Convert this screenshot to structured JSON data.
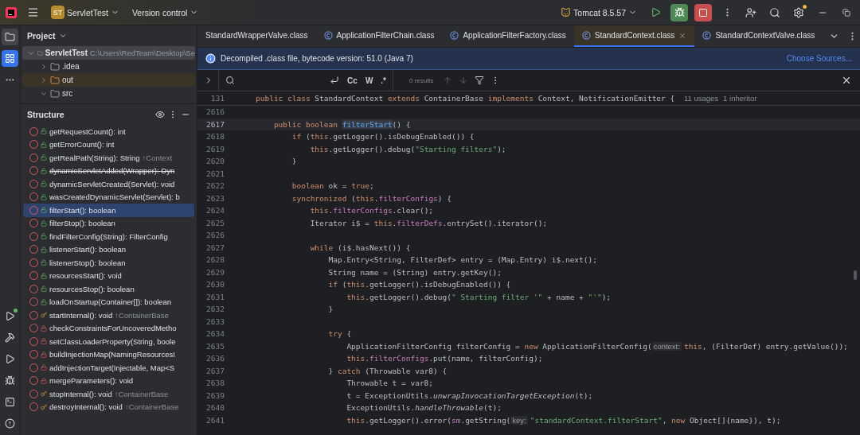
{
  "title_bar": {
    "project_badge": "ST",
    "project": "ServletTest",
    "vcs": "Version control",
    "run_config": "Tomcat 8.5.57"
  },
  "tool_strip": {
    "top": [
      {
        "kind": "project",
        "selected": true
      },
      {
        "kind": "structure",
        "selected": true
      },
      {
        "kind": "more",
        "selected": false
      }
    ],
    "bottom": [
      {
        "kind": "services",
        "selected": false
      },
      {
        "kind": "build",
        "selected": false
      },
      {
        "kind": "run",
        "selected": false
      },
      {
        "kind": "debug",
        "selected": false
      },
      {
        "kind": "terminal",
        "selected": false
      },
      {
        "kind": "problems",
        "selected": false
      }
    ]
  },
  "project_panel": {
    "title": "Project",
    "tree": [
      {
        "label": "ServletTest",
        "path": "C:\\Users\\RedTeam\\Desktop\\Se",
        "selected": true,
        "expanded": true,
        "excluded": false,
        "children": [
          {
            "label": ".idea",
            "selected": false,
            "expanded": false,
            "excluded": false
          },
          {
            "label": "out",
            "selected": false,
            "expanded": false,
            "excluded": true
          },
          {
            "label": "src",
            "selected": false,
            "expanded": true,
            "excluded": false
          }
        ]
      }
    ]
  },
  "structure_panel": {
    "title": "Structure",
    "items": [
      {
        "label": "getRequestCount(): int",
        "kind": "public",
        "selected": false,
        "deprecated": false
      },
      {
        "label": "getErrorCount(): int",
        "kind": "public",
        "selected": false,
        "deprecated": false
      },
      {
        "label": "getRealPath(String): String",
        "inherited": "↑Context",
        "kind": "public",
        "selected": false,
        "deprecated": false
      },
      {
        "label": "dynamicServletAdded(Wrapper): Dyn",
        "kind": "public",
        "selected": false,
        "deprecated": true
      },
      {
        "label": "dynamicServletCreated(Servlet): void",
        "kind": "public",
        "selected": false,
        "deprecated": false
      },
      {
        "label": "wasCreatedDynamicServlet(Servlet): b",
        "kind": "public",
        "selected": false,
        "deprecated": false
      },
      {
        "label": "filterStart(): boolean",
        "kind": "public",
        "selected": true,
        "deprecated": false
      },
      {
        "label": "filterStop(): boolean",
        "kind": "public",
        "selected": false,
        "deprecated": false
      },
      {
        "label": "findFilterConfig(String): FilterConfig",
        "kind": "public",
        "selected": false,
        "deprecated": false
      },
      {
        "label": "listenerStart(): boolean",
        "kind": "public",
        "selected": false,
        "deprecated": false
      },
      {
        "label": "listenerStop(): boolean",
        "kind": "public",
        "selected": false,
        "deprecated": false
      },
      {
        "label": "resourcesStart(): void",
        "kind": "public",
        "selected": false,
        "deprecated": false
      },
      {
        "label": "resourcesStop(): boolean",
        "kind": "public",
        "selected": false,
        "deprecated": false
      },
      {
        "label": "loadOnStartup(Container[]): boolean",
        "kind": "public",
        "selected": false,
        "deprecated": false
      },
      {
        "label": "startInternal(): void",
        "inherited": "↑ContainerBase",
        "kind": "protected",
        "selected": false,
        "deprecated": false
      },
      {
        "label": "checkConstraintsForUncoveredMetho",
        "kind": "private",
        "selected": false,
        "deprecated": false
      },
      {
        "label": "setClassLoaderProperty(String, boole",
        "kind": "private",
        "selected": false,
        "deprecated": false
      },
      {
        "label": "buildInjectionMap(NamingResourcesI",
        "kind": "private",
        "selected": false,
        "deprecated": false
      },
      {
        "label": "addInjectionTarget(Injectable, Map<S",
        "kind": "private",
        "selected": false,
        "deprecated": false
      },
      {
        "label": "mergeParameters(): void",
        "kind": "private",
        "selected": false,
        "deprecated": false
      },
      {
        "label": "stopInternal(): void",
        "inherited": "↑ContainerBase",
        "kind": "protected",
        "selected": false,
        "deprecated": false
      },
      {
        "label": "destroyInternal(): void",
        "inherited": "↑ContainerBase",
        "kind": "protected",
        "selected": false,
        "deprecated": false
      }
    ]
  },
  "tabs": [
    {
      "label": "StandardWrapperValve.class",
      "icon": false,
      "selected": false
    },
    {
      "label": "ApplicationFilterChain.class",
      "icon": true,
      "selected": false
    },
    {
      "label": "ApplicationFilterFactory.class",
      "icon": true,
      "selected": false
    },
    {
      "label": "StandardContext.class",
      "icon": true,
      "selected": true
    },
    {
      "label": "StandardContextValve.class",
      "icon": true,
      "selected": false
    }
  ],
  "banner": {
    "message": "Decompiled .class file, bytecode version: 51.0 (Java 7)",
    "link": "Choose Sources..."
  },
  "find_bar": {
    "match_case": "Cc",
    "words": "W",
    "regex": ".*",
    "results": "0 results"
  },
  "editor": {
    "sticky": {
      "no": "131",
      "tokens": [
        {
          "kind": "kw",
          "text": "public class "
        },
        {
          "kind": "p",
          "text": "StandardContext "
        },
        {
          "kind": "kw",
          "text": "extends "
        },
        {
          "kind": "p",
          "text": "ContainerBase "
        },
        {
          "kind": "kw",
          "text": "implements "
        },
        {
          "kind": "p",
          "text": "Context, NotificationEmitter { "
        },
        {
          "kind": "usage",
          "text": "11 usages"
        },
        {
          "kind": "usage",
          "text": "1 inheritor"
        }
      ]
    },
    "lines": [
      {
        "no": "2616",
        "current": false
      },
      {
        "no": "2617",
        "current": true,
        "tokens": [
          {
            "kind": "kw",
            "text": "    public boolean "
          },
          {
            "kind": "decl",
            "text": "filterStart"
          },
          {
            "kind": "p",
            "text": "() {"
          }
        ]
      },
      {
        "no": "2618",
        "current": false,
        "tokens": [
          {
            "kind": "kw",
            "text": "        if "
          },
          {
            "kind": "p",
            "text": "("
          },
          {
            "kind": "kw",
            "text": "this"
          },
          {
            "kind": "p",
            "text": ".getLogger().isDebugEnabled()) {"
          }
        ]
      },
      {
        "no": "2619",
        "current": false,
        "tokens": [
          {
            "kind": "kw",
            "text": "            this"
          },
          {
            "kind": "p",
            "text": ".getLogger().debug("
          },
          {
            "kind": "str",
            "text": "\"Starting filters\""
          },
          {
            "kind": "p",
            "text": ");"
          }
        ]
      },
      {
        "no": "2620",
        "current": false,
        "tokens": [
          {
            "kind": "p",
            "text": "        }"
          }
        ]
      },
      {
        "no": "2621",
        "current": false
      },
      {
        "no": "2622",
        "current": false,
        "tokens": [
          {
            "kind": "kw",
            "text": "        boolean "
          },
          {
            "kind": "p",
            "text": "ok = "
          },
          {
            "kind": "kw",
            "text": "true"
          },
          {
            "kind": "p",
            "text": ";"
          }
        ]
      },
      {
        "no": "2623",
        "current": false,
        "tokens": [
          {
            "kind": "kw",
            "text": "        synchronized "
          },
          {
            "kind": "p",
            "text": "("
          },
          {
            "kind": "kw",
            "text": "this"
          },
          {
            "kind": "p",
            "text": "."
          },
          {
            "kind": "f",
            "text": "filterConfigs"
          },
          {
            "kind": "p",
            "text": ") {"
          }
        ]
      },
      {
        "no": "2624",
        "current": false,
        "tokens": [
          {
            "kind": "kw",
            "text": "            this"
          },
          {
            "kind": "p",
            "text": "."
          },
          {
            "kind": "f",
            "text": "filterConfigs"
          },
          {
            "kind": "p",
            "text": ".clear();"
          }
        ]
      },
      {
        "no": "2625",
        "current": false,
        "tokens": [
          {
            "kind": "p",
            "text": "            Iterator i$ = "
          },
          {
            "kind": "kw",
            "text": "this"
          },
          {
            "kind": "p",
            "text": "."
          },
          {
            "kind": "f",
            "text": "filterDefs"
          },
          {
            "kind": "p",
            "text": ".entrySet().iterator();"
          }
        ]
      },
      {
        "no": "2626",
        "current": false
      },
      {
        "no": "2627",
        "current": false,
        "tokens": [
          {
            "kind": "kw",
            "text": "            while "
          },
          {
            "kind": "p",
            "text": "(i$.hasNext()) {"
          }
        ]
      },
      {
        "no": "2628",
        "current": false,
        "tokens": [
          {
            "kind": "p",
            "text": "                Map.Entry<String, FilterDef> entry = (Map.Entry) i$.next();"
          }
        ]
      },
      {
        "no": "2629",
        "current": false,
        "tokens": [
          {
            "kind": "p",
            "text": "                String name = (String) entry.getKey();"
          }
        ]
      },
      {
        "no": "2630",
        "current": false,
        "tokens": [
          {
            "kind": "kw",
            "text": "                if "
          },
          {
            "kind": "p",
            "text": "("
          },
          {
            "kind": "kw",
            "text": "this"
          },
          {
            "kind": "p",
            "text": ".getLogger().isDebugEnabled()) {"
          }
        ]
      },
      {
        "no": "2631",
        "current": false,
        "tokens": [
          {
            "kind": "kw",
            "text": "                    this"
          },
          {
            "kind": "p",
            "text": ".getLogger().debug("
          },
          {
            "kind": "str",
            "text": "\" Starting filter '\""
          },
          {
            "kind": "p",
            "text": " + name + "
          },
          {
            "kind": "str",
            "text": "\"'\""
          },
          {
            "kind": "p",
            "text": ");"
          }
        ]
      },
      {
        "no": "2632",
        "current": false,
        "tokens": [
          {
            "kind": "p",
            "text": "                }"
          }
        ]
      },
      {
        "no": "2633",
        "current": false
      },
      {
        "no": "2634",
        "current": false,
        "tokens": [
          {
            "kind": "kw",
            "text": "                try "
          },
          {
            "kind": "p",
            "text": "{"
          }
        ]
      },
      {
        "no": "2635",
        "current": false,
        "tokens": [
          {
            "kind": "p",
            "text": "                    ApplicationFilterConfig filterConfig = "
          },
          {
            "kind": "kw",
            "text": "new "
          },
          {
            "kind": "p",
            "text": "ApplicationFilterConfig("
          },
          {
            "kind": "hint",
            "text": "context:"
          },
          {
            "kind": "kw",
            "text": "this"
          },
          {
            "kind": "p",
            "text": ", (FilterDef) entry.getValue());"
          }
        ]
      },
      {
        "no": "2636",
        "current": false,
        "tokens": [
          {
            "kind": "kw",
            "text": "                    this"
          },
          {
            "kind": "p",
            "text": "."
          },
          {
            "kind": "f",
            "text": "filterConfigs"
          },
          {
            "kind": "p",
            "text": ".put(name, filterConfig);"
          }
        ]
      },
      {
        "no": "2637",
        "current": false,
        "tokens": [
          {
            "kind": "p",
            "text": "                } "
          },
          {
            "kind": "kw",
            "text": "catch "
          },
          {
            "kind": "p",
            "text": "(Throwable var8) {"
          }
        ]
      },
      {
        "no": "2638",
        "current": false,
        "tokens": [
          {
            "kind": "p",
            "text": "                    Throwable t = var8;"
          }
        ]
      },
      {
        "no": "2639",
        "current": false,
        "tokens": [
          {
            "kind": "p",
            "text": "                    t = ExceptionUtils."
          },
          {
            "kind": "it",
            "text": "unwrapInvocationTargetException"
          },
          {
            "kind": "p",
            "text": "(t);"
          }
        ]
      },
      {
        "no": "2640",
        "current": false,
        "tokens": [
          {
            "kind": "p",
            "text": "                    ExceptionUtils."
          },
          {
            "kind": "it",
            "text": "handleThrowable"
          },
          {
            "kind": "p",
            "text": "(t);"
          }
        ]
      },
      {
        "no": "2641",
        "current": false,
        "tokens": [
          {
            "kind": "kw",
            "text": "                    this"
          },
          {
            "kind": "p",
            "text": ".getLogger().error("
          },
          {
            "kind": "f",
            "text": "sm"
          },
          {
            "kind": "p",
            "text": ".getString("
          },
          {
            "kind": "hint",
            "text": "key:"
          },
          {
            "kind": "str",
            "text": "\"standardContext.filterStart\""
          },
          {
            "kind": "p",
            "text": ", "
          },
          {
            "kind": "kw",
            "text": "new "
          },
          {
            "kind": "p",
            "text": "Object[]{name}), t);"
          }
        ]
      }
    ]
  }
}
